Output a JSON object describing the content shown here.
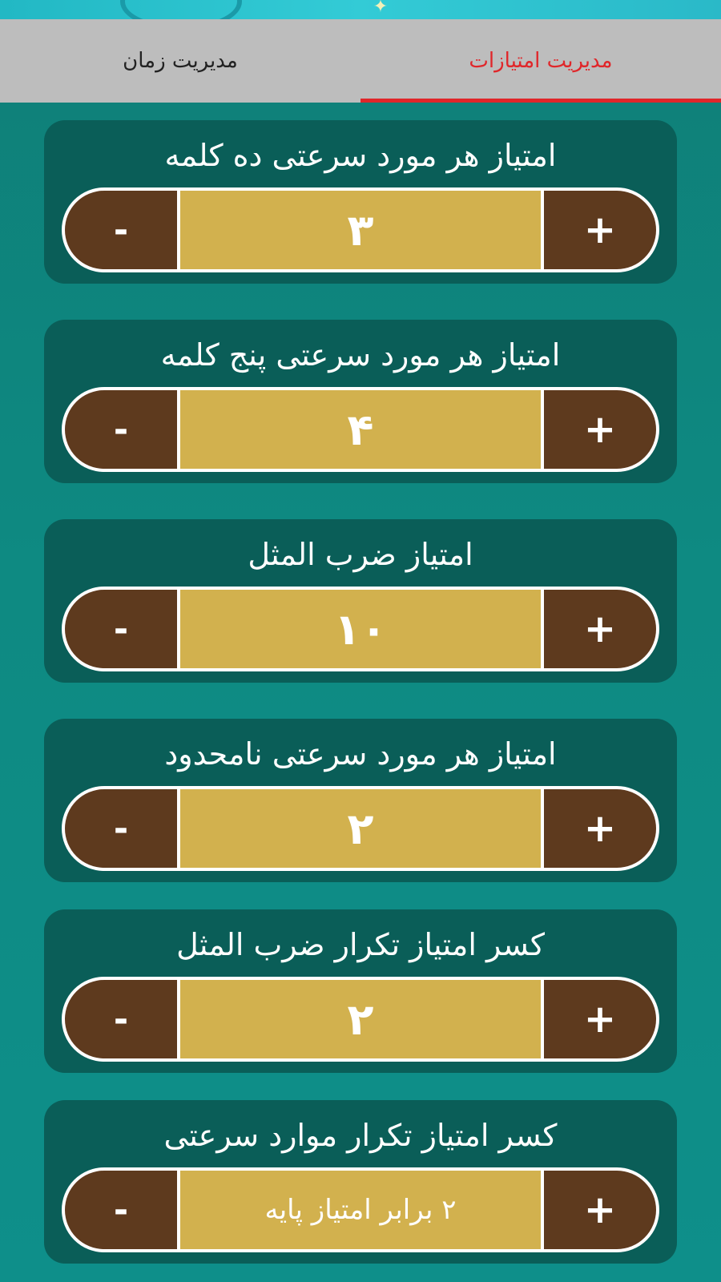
{
  "tabs": [
    {
      "label": "مدیریت امتیازات",
      "active": true
    },
    {
      "label": "مدیریت زمان",
      "active": false
    }
  ],
  "colors": {
    "accent": "#e0262a",
    "card": "#0a5e58",
    "button": "#5e3a1e",
    "value_field": "#d2b14e"
  },
  "settings": [
    {
      "title": "امتیاز هر مورد سرعتی ده کلمه",
      "value": "۳",
      "minus": "-",
      "plus": "+"
    },
    {
      "title": "امتیاز هر مورد سرعتی پنج کلمه",
      "value": "۴",
      "minus": "-",
      "plus": "+"
    },
    {
      "title": "امتیاز ضرب المثل",
      "value": "۱۰",
      "minus": "-",
      "plus": "+"
    },
    {
      "title": "امتیاز هر مورد سرعتی نامحدود",
      "value": "۲",
      "minus": "-",
      "plus": "+"
    },
    {
      "title": "کسر امتیاز تکرار ضرب المثل",
      "value": "۲",
      "minus": "-",
      "plus": "+"
    },
    {
      "title": "کسر امتیاز تکرار موارد سرعتی",
      "value": "۲ برابر امتیاز پایه",
      "minus": "-",
      "plus": "+"
    }
  ]
}
